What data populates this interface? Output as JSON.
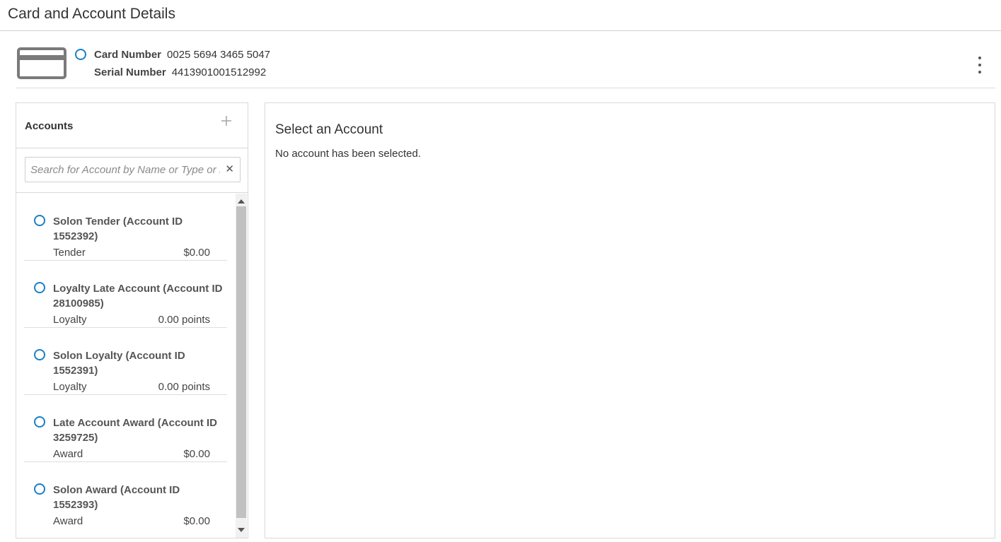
{
  "page": {
    "title": "Card and Account Details"
  },
  "card": {
    "icon": "credit-card-icon",
    "status_icon": "status-ring-icon",
    "card_number_label": "Card Number",
    "card_number": "0025 5694 3465 5047",
    "serial_number_label": "Serial Number",
    "serial_number": "4413901001512992",
    "menu_icon": "kebab-menu-icon"
  },
  "accounts": {
    "title": "Accounts",
    "add_icon": "plus-icon",
    "search": {
      "placeholder": "Search for Account by Name or Type or ID",
      "value": "",
      "clear_icon": "close-icon"
    },
    "items": [
      {
        "name": "Solon Tender (Account ID 1552392)",
        "type": "Tender",
        "amount": "$0.00"
      },
      {
        "name": "Loyalty Late Account (Account ID 28100985)",
        "type": "Loyalty",
        "amount": "0.00 points"
      },
      {
        "name": "Solon Loyalty (Account ID 1552391)",
        "type": "Loyalty",
        "amount": "0.00 points"
      },
      {
        "name": "Late Account Award (Account ID 3259725)",
        "type": "Award",
        "amount": "$0.00"
      },
      {
        "name": "Solon Award (Account ID 1552393)",
        "type": "Award",
        "amount": "$0.00"
      }
    ]
  },
  "detail": {
    "title": "Select an Account",
    "message": "No account has been selected."
  },
  "colors": {
    "accent": "#1a7fc6",
    "divider": "#d9d9d9",
    "scroll_thumb": "#c1c1c1"
  }
}
